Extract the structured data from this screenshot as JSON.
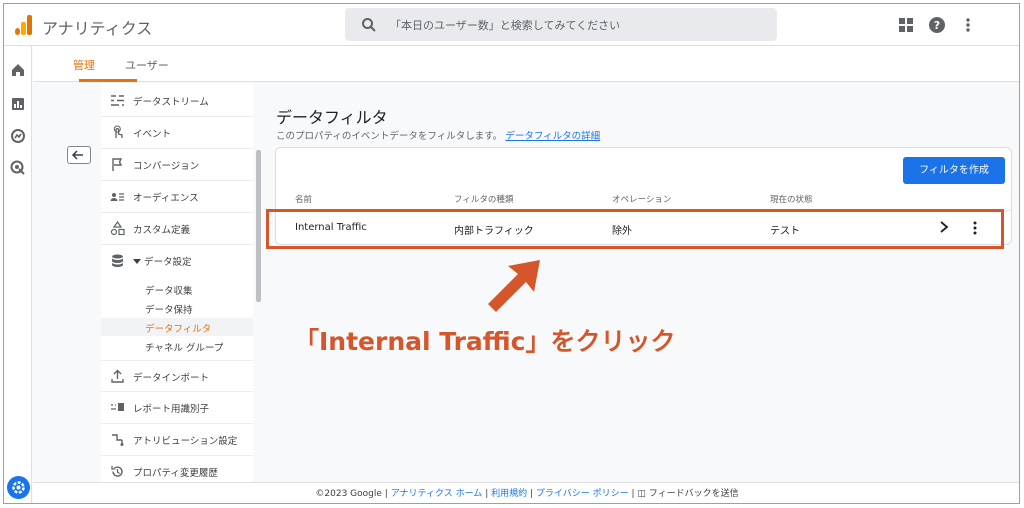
{
  "app": {
    "title": "アナリティクス"
  },
  "search": {
    "placeholder": "「本日のユーザー数」と検索してみてください"
  },
  "tabs": [
    {
      "label": "管理"
    },
    {
      "label": "ユーザー"
    }
  ],
  "nav": {
    "items": [
      {
        "label": "データストリーム",
        "icon": "data-stream-icon"
      },
      {
        "label": "イベント",
        "icon": "touch-icon"
      },
      {
        "label": "コンバージョン",
        "icon": "flag-icon"
      },
      {
        "label": "オーディエンス",
        "icon": "audience-icon"
      },
      {
        "label": "カスタム定義",
        "icon": "shapes-icon"
      },
      {
        "label": "データ設定",
        "icon": "database-icon"
      }
    ],
    "sub_items": [
      {
        "label": "データ収集"
      },
      {
        "label": "データ保持"
      },
      {
        "label": "データフィルタ"
      },
      {
        "label": "チャネル グループ"
      }
    ],
    "lower_items": [
      {
        "label": "データインポート",
        "icon": "upload-icon"
      },
      {
        "label": "レポート用識別子",
        "icon": "identity-icon"
      },
      {
        "label": "アトリビューション設定",
        "icon": "attribution-icon"
      },
      {
        "label": "プロパティ変更履歴",
        "icon": "history-icon"
      }
    ]
  },
  "main": {
    "title": "データフィルタ",
    "description": "このプロパティのイベントデータをフィルタします。",
    "description_link": "データフィルタの詳細",
    "create_button": "フィルタを作成",
    "columns": [
      "名前",
      "フィルタの種類",
      "オペレーション",
      "現在の状態"
    ],
    "rows": [
      {
        "name": "Internal Traffic",
        "type": "内部トラフィック",
        "operation": "除外",
        "state": "テスト"
      }
    ]
  },
  "annotation": {
    "callout": "「Internal Traffic」をクリック",
    "color": "#d4562a"
  },
  "footer": {
    "copyright": "©2023 Google",
    "links": [
      "アナリティクス ホーム",
      "利用規約",
      "プライバシー ポリシー"
    ],
    "feedback": "フィードバックを送信"
  },
  "colors": {
    "accent": "#e8710a",
    "primary": "#1a73e8"
  }
}
